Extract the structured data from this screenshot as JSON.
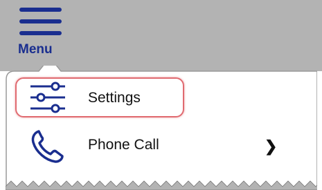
{
  "header": {
    "menu_label": "Menu",
    "menu_icon": "hamburger-icon"
  },
  "menu": {
    "items": [
      {
        "label": "Settings",
        "icon": "sliders-icon",
        "highlighted": true
      },
      {
        "label": "Phone Call",
        "icon": "phone-icon",
        "submenu_icon": "chevron-right-icon"
      }
    ]
  },
  "colors": {
    "accent": "#1a2e8f",
    "highlight": "#e06a70",
    "header_bg": "#b3b3b3"
  }
}
